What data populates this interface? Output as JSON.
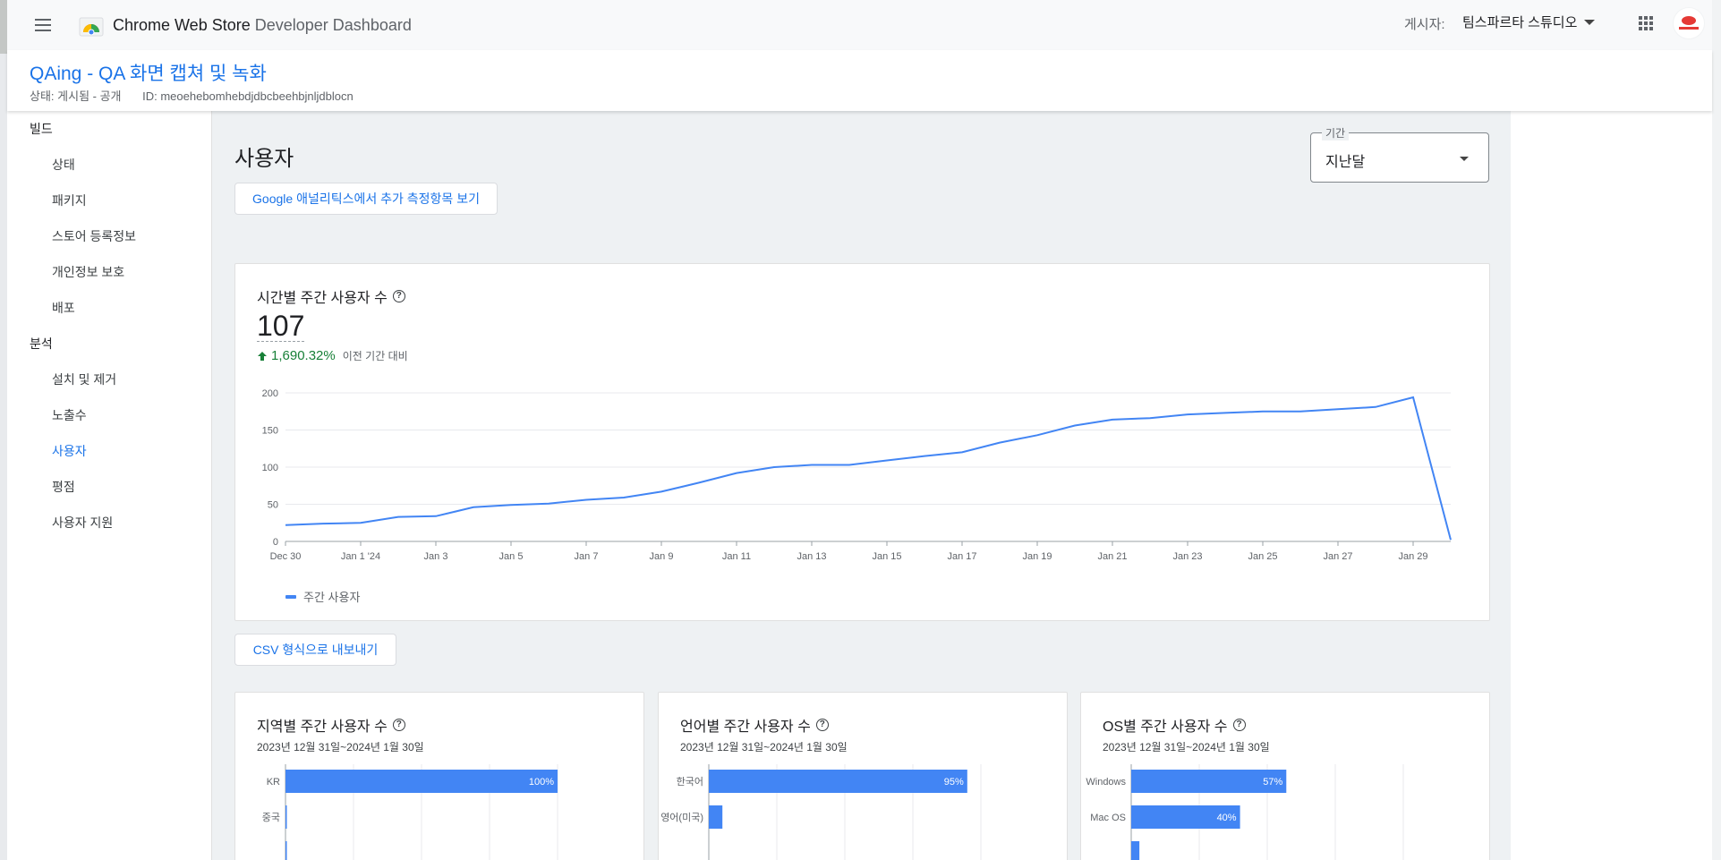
{
  "topbar": {
    "app_title_brand": "Chrome Web Store",
    "app_title_rest": "Developer Dashboard",
    "publisher_label": "게시자:",
    "publisher_name": "팀스파르타 스튜디오"
  },
  "item": {
    "title": "QAing - QA 화면 캡쳐 및 녹화",
    "status": "상태: 게시됨 - 공개",
    "id": "ID: meoehebomhebdjdbcbeehbjnljdblocn"
  },
  "sidebar": {
    "sections": [
      {
        "label": "빌드",
        "items": [
          "상태",
          "패키지",
          "스토어 등록정보",
          "개인정보 보호",
          "배포"
        ]
      },
      {
        "label": "분석",
        "items": [
          "설치 및 제거",
          "노출수",
          "사용자",
          "평점",
          "사용자 지원"
        ]
      }
    ],
    "active": "사용자"
  },
  "main": {
    "page_title": "사용자",
    "analytics_button": "Google 애널리틱스에서 추가 측정항목 보기",
    "period_label": "기간",
    "period_value": "지난달",
    "csv_button": "CSV 형식으로 내보내기"
  },
  "weekly_card": {
    "title": "시간별 주간 사용자 수",
    "total": "107",
    "delta": "1,690.32%",
    "delta_note": "이전 기간 대비",
    "legend": "주간 사용자"
  },
  "chart_data": [
    {
      "type": "line",
      "title": "시간별 주간 사용자 수",
      "x": [
        "Dec 30",
        "Dec 31",
        "Jan 1 '24",
        "Jan 2",
        "Jan 3",
        "Jan 4",
        "Jan 5",
        "Jan 6",
        "Jan 7",
        "Jan 8",
        "Jan 9",
        "Jan 10",
        "Jan 11",
        "Jan 12",
        "Jan 13",
        "Jan 14",
        "Jan 15",
        "Jan 16",
        "Jan 17",
        "Jan 18",
        "Jan 19",
        "Jan 20",
        "Jan 21",
        "Jan 22",
        "Jan 23",
        "Jan 24",
        "Jan 25",
        "Jan 26",
        "Jan 27",
        "Jan 28",
        "Jan 29",
        "Jan 30"
      ],
      "x_ticks": [
        "Dec 30",
        "Jan 1 '24",
        "Jan 3",
        "Jan 5",
        "Jan 7",
        "Jan 9",
        "Jan 11",
        "Jan 13",
        "Jan 15",
        "Jan 17",
        "Jan 19",
        "Jan 21",
        "Jan 23",
        "Jan 25",
        "Jan 27",
        "Jan 29"
      ],
      "series": [
        {
          "name": "주간 사용자",
          "values": [
            22,
            24,
            25,
            33,
            34,
            46,
            49,
            51,
            56,
            59,
            67,
            79,
            92,
            100,
            103,
            103,
            109,
            115,
            120,
            133,
            143,
            156,
            164,
            166,
            171,
            173,
            175,
            175,
            178,
            181,
            194,
            2
          ]
        }
      ],
      "yticks": [
        0,
        50,
        100,
        150,
        200
      ],
      "ylim": [
        0,
        210
      ],
      "color": "#4285f4",
      "grid": true
    },
    {
      "type": "bar",
      "title": "지역별 주간 사용자 수",
      "subtitle": "2023년 12월 31일~2024년 1월 30일",
      "categories": [
        "KR",
        "중국",
        ""
      ],
      "values": [
        100,
        0.3,
        0.3
      ],
      "value_labels": [
        "100%",
        "",
        ""
      ],
      "unit": "%"
    },
    {
      "type": "bar",
      "title": "언어별 주간 사용자 수",
      "subtitle": "2023년 12월 31일~2024년 1월 30일",
      "categories": [
        "한국어",
        "영어(미국)"
      ],
      "values": [
        95,
        5
      ],
      "value_labels": [
        "95%",
        ""
      ],
      "unit": "%"
    },
    {
      "type": "bar",
      "title": "OS별 주간 사용자 수",
      "subtitle": "2023년 12월 31일~2024년 1월 30일",
      "categories": [
        "Windows",
        "Mac OS",
        ""
      ],
      "values": [
        57,
        40,
        3
      ],
      "value_labels": [
        "57%",
        "40%",
        ""
      ],
      "unit": "%"
    }
  ]
}
